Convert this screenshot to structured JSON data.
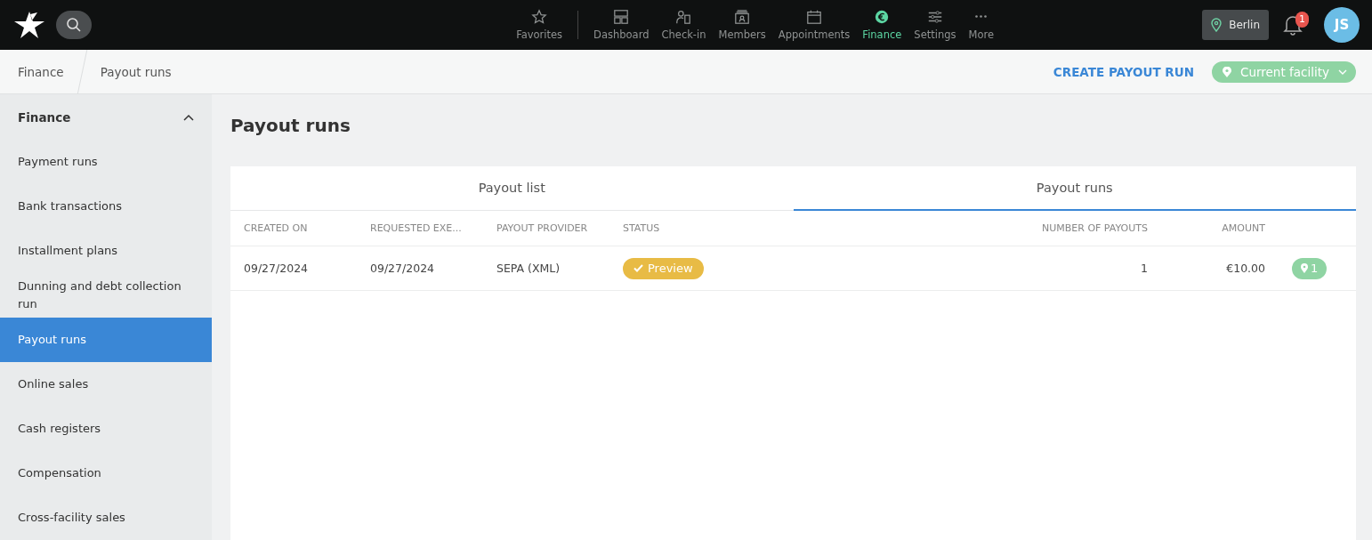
{
  "topbar": {
    "nav": [
      {
        "label": "Favorites",
        "selected": false
      },
      {
        "label": "Dashboard",
        "selected": false
      },
      {
        "label": "Check-in",
        "selected": false
      },
      {
        "label": "Members",
        "selected": false
      },
      {
        "label": "Appointments",
        "selected": false
      },
      {
        "label": "Finance",
        "selected": true
      },
      {
        "label": "Settings",
        "selected": false
      },
      {
        "label": "More",
        "selected": false
      }
    ],
    "location": "Berlin",
    "notifications": "1",
    "avatar": "JS"
  },
  "breadcrumb": [
    "Finance",
    "Payout runs"
  ],
  "actions": {
    "create": "CREATE PAYOUT RUN",
    "facility": "Current facility"
  },
  "sidebar": {
    "title": "Finance",
    "expanded": true,
    "items": [
      {
        "label": "Payment runs",
        "selected": false
      },
      {
        "label": "Bank transactions",
        "selected": false
      },
      {
        "label": "Installment plans",
        "selected": false
      },
      {
        "label": "Dunning and debt collection run",
        "selected": false
      },
      {
        "label": "Payout runs",
        "selected": true
      },
      {
        "label": "Online sales",
        "selected": false
      },
      {
        "label": "Cash registers",
        "selected": false
      },
      {
        "label": "Compensation",
        "selected": false
      },
      {
        "label": "Cross-facility sales",
        "selected": false
      }
    ]
  },
  "page_title": "Payout runs",
  "tabs": [
    {
      "label": "Payout list",
      "selected": false
    },
    {
      "label": "Payout runs",
      "selected": true
    }
  ],
  "table": {
    "columns": [
      "CREATED ON",
      "REQUESTED EXE...",
      "PAYOUT PROVIDER",
      "STATUS",
      "NUMBER OF PAYOUTS",
      "AMOUNT"
    ],
    "rows": [
      {
        "created_on": "09/27/2024",
        "requested": "09/27/2024",
        "provider": "SEPA (XML)",
        "status": {
          "label": "Preview",
          "kind": "preview"
        },
        "count": "1",
        "amount": "€10.00",
        "locations": "1"
      }
    ]
  }
}
